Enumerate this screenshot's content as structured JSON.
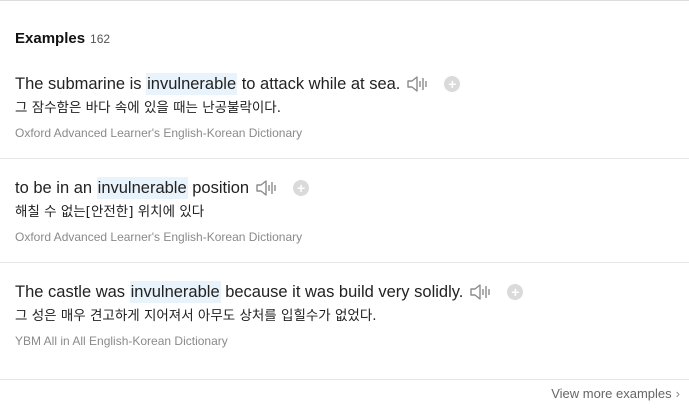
{
  "header": {
    "title": "Examples",
    "count": "162"
  },
  "examples": [
    {
      "before": "The submarine is ",
      "highlight": "invulnerable",
      "after": " to attack while at sea.",
      "translation": "그 잠수함은 바다 속에 있을 때는 난공불락이다.",
      "source": "Oxford Advanced Learner's English-Korean Dictionary"
    },
    {
      "before": "to be in an ",
      "highlight": "invulnerable",
      "after": " position",
      "translation": "해칠 수 없는[안전한] 위치에 있다",
      "source": "Oxford Advanced Learner's English-Korean Dictionary"
    },
    {
      "before": "The castle was ",
      "highlight": "invulnerable",
      "after": " because it was build very solidly.",
      "translation": "그 성은 매우 견고하게 지어져서 아무도 상처를 입힐수가 없었다.",
      "source": "YBM All in All English-Korean Dictionary"
    }
  ],
  "icons": {
    "audio": "speaker-icon",
    "add": "plus-circle-icon",
    "more": "chevron-right-icon"
  },
  "footer": {
    "view_more": "View more examples"
  },
  "colors": {
    "highlight_bg": "#e8f3fb",
    "source_text": "#8a8a8a",
    "plus_bg": "#dadada"
  }
}
